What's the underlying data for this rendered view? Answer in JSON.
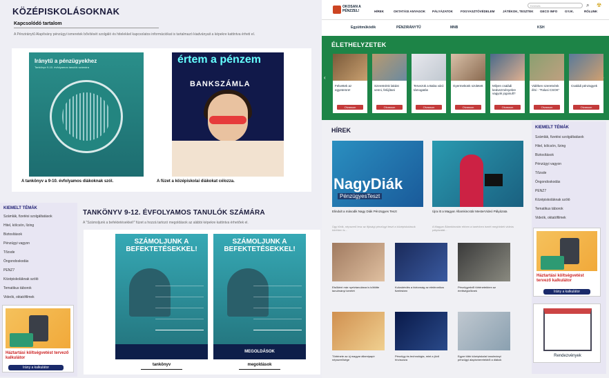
{
  "left": {
    "title": "KÖZÉPISKOLÁSOKNAK",
    "related_heading": "Kapcsolódó tartalom",
    "intro": "A Pénziránytű Alapítvány pénzügyi ismeretek bővítését szolgáló és hitelekkel kapcsolatos információkat is tartalmazó kiadványait a képekre kattintva érheti el.",
    "book1": {
      "title": "Iránytű a pénzügyekhez",
      "subtitle": "Tankönyv 9-10. évfolyamos tanulók számára",
      "caption": "A tankönyv a 9-10. évfolyamos diákoknak szól."
    },
    "book2": {
      "title": "értem a pénzem",
      "word": "BANKSZÁMLA",
      "brand": "PÉNZIRÁNYTŰ",
      "caption": "A füzet a középiskolai diákokat célozza."
    },
    "section2_title": "TANKÖNYV 9-12. ÉVFOLYAMOS TANULÓK SZÁMÁRA",
    "section2_intro": "A \"Számoljunk a befektetésekkel!\" füzet a hozzá tartozó megoldások az alábbi képekre kattintva érhetőek el.",
    "tb1": {
      "top": "SZÁMOLJUNK A BEFEKTETÉSEKKEL!",
      "label": "",
      "caption": "tankönyv"
    },
    "tb2": {
      "top": "SZÁMOLJUNK A BEFEKTETÉSEKKEL!",
      "label": "MEGOLDÁSOK",
      "caption": "megoldások"
    }
  },
  "sidebar": {
    "title": "KIEMELT TÉMÁK",
    "items": [
      "Számlák, fizetési szolgáltatások",
      "Hitel, kölcsön, lízing",
      "Biztosítások",
      "Pénzügyi vagyon",
      "Tőzsde",
      "Öngondoskodás",
      "PENZ7",
      "Középiskoláknak szóló",
      "Tematikus táborok",
      "Videók, oktatófilmek"
    ],
    "calc_title": "Háztartási költségvetést tervező kalkulátor",
    "calc_button": "Irány a kalkulátor"
  },
  "site": {
    "logo": "OKOSAN A PÉNZZEL!",
    "nav": [
      "HÍREK",
      "OKTATÁSI ANYAGOK",
      "PÁLYÁZATOK",
      "FOGYASZTÓVÉDELEM",
      "JÁTÉKOK, TESZTEK",
      "GECO INFO",
      "GY.IK.",
      "RÓLUNK"
    ],
    "search_placeholder": "Keresés",
    "partners": [
      "Együttműködik",
      "PÉNZIRÁNYTŰ",
      "MNB",
      "",
      "KSH",
      "",
      ""
    ]
  },
  "life": {
    "title": "ÉLETHELYZETEK",
    "cards": [
      {
        "text": "Felvettek az egyetemre!",
        "button": "Olvasson"
      },
      {
        "text": "Szeretnénk lakást venni, felújítani",
        "button": "Olvasson"
      },
      {
        "text": "Tervezük a Baba váró támogatás",
        "button": "Olvasson"
      },
      {
        "text": "Gyermekünk született",
        "button": "Olvasson"
      },
      {
        "text": "Milyen családi kedvezményekre vagyok jogosult?",
        "button": "Olvasson"
      },
      {
        "text": "Vidéken szeretnénk élni - \"Falusi CSOK\"",
        "button": "Olvasson"
      },
      {
        "text": "Családi pénzügyek",
        "button": "Olvasson"
      }
    ]
  },
  "news": {
    "title": "HÍREK",
    "big": [
      {
        "overlay": "NagyDiák",
        "sub": "PénzügyesTeszt",
        "title": "Elindult a második Nagy Diák Pénzügyes Teszt",
        "desc": "Úgy tűnik, népszerű lesz az ifjúsági pénzügyi teszt a középiskolások körében is..."
      },
      {
        "overlay": "",
        "sub": "",
        "title": "Újra itt a Magyar Államkincstár MesterVideó Pályázata",
        "desc": "A Magyar Államkincstár ebben a tanévben ismét meghirdeti videós pályázatát..."
      }
    ],
    "small": [
      {
        "title": "Elsőként már nyelvtanulásra is költötte tanulmányi keretét"
      },
      {
        "title": "Kulcskérdés a biztonság az elektronikus fizetésben"
      },
      {
        "title": "Pénzügyekről történetekben az érettségizőknek"
      },
      {
        "title": "Története az új magyar államipapír népszerűsége"
      },
      {
        "title": "Pénzügy és technológia, mint a jövő hívószava"
      },
      {
        "title": "Egyre több középiskolai tanulmányi pénzügyi alapismeretekből a diákok"
      }
    ],
    "calendar_caption": "Rendezvények"
  }
}
